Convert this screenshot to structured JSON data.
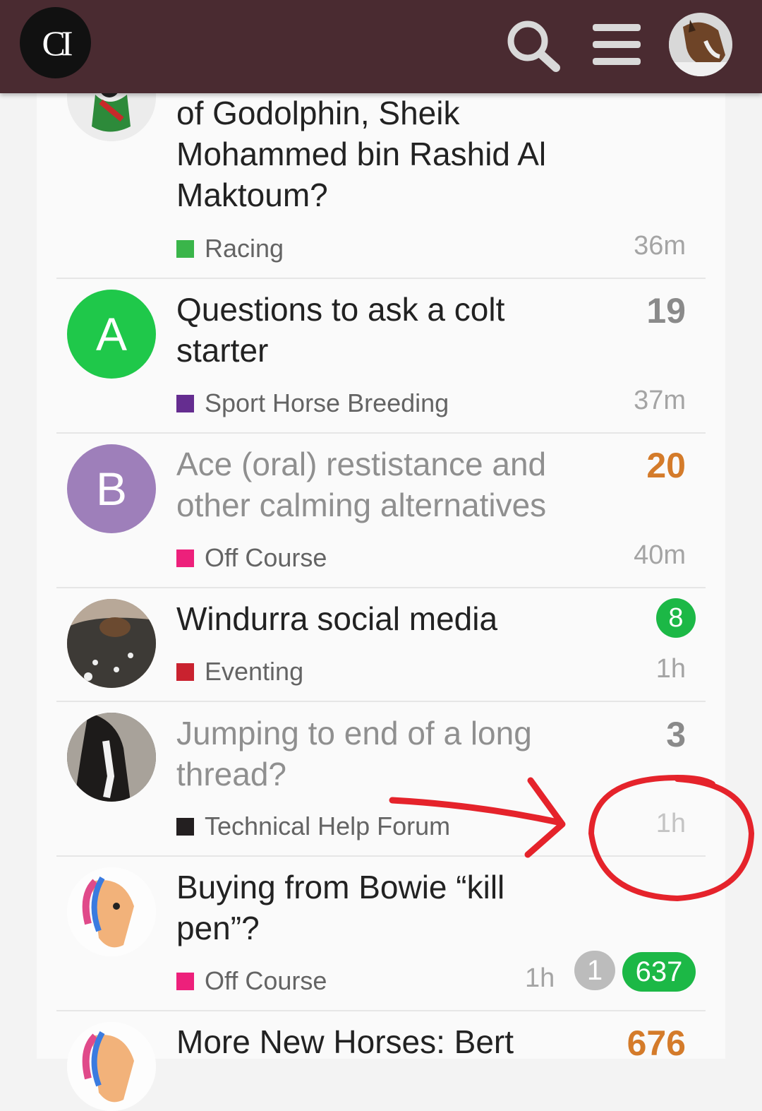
{
  "header": {
    "logo_text": "CI",
    "search_icon": "search-icon",
    "menu_icon": "hamburger-menu-icon",
    "avatar_icon": "user-avatar",
    "bg_color": "#4a2b31"
  },
  "topics": [
    {
      "title": "of Godolphin, Sheik Mohammed bin Rashid Al Maktoum?",
      "category": "Racing",
      "category_color": "#3ab54a",
      "count": "",
      "time": "36m"
    },
    {
      "title": "Questions to ask a colt starter",
      "category": "Sport Horse Breeding",
      "category_color": "#652d90",
      "avatar_letter": "A",
      "avatar_color": "#1fc84a",
      "count": "19",
      "time": "37m"
    },
    {
      "title": "Ace (oral) restistance and other calming alternatives",
      "category": "Off Course",
      "category_color": "#ed207b",
      "avatar_letter": "B",
      "avatar_color": "#9e7fba",
      "count": "20",
      "count_color": "#d47b2a",
      "time": "40m"
    },
    {
      "title": "Windurra social media",
      "category": "Eventing",
      "category_color": "#c9222f",
      "new_count": "8",
      "time": "1h"
    },
    {
      "title": "Jumping to end of a long thread?",
      "category": "Technical Help Forum",
      "category_color": "#231f20",
      "count": "3",
      "time": "1h"
    },
    {
      "title": "Buying from Bowie “kill pen”?",
      "category": "Off Course",
      "category_color": "#ed207b",
      "time": "1h",
      "unread_count": "1",
      "new_count": "637"
    },
    {
      "title": "More New Horses: Bert",
      "count": "676",
      "count_color": "#d47b2a"
    }
  ],
  "annotation": {
    "color": "#e5232b",
    "shapes": [
      "arrow",
      "circle"
    ]
  }
}
